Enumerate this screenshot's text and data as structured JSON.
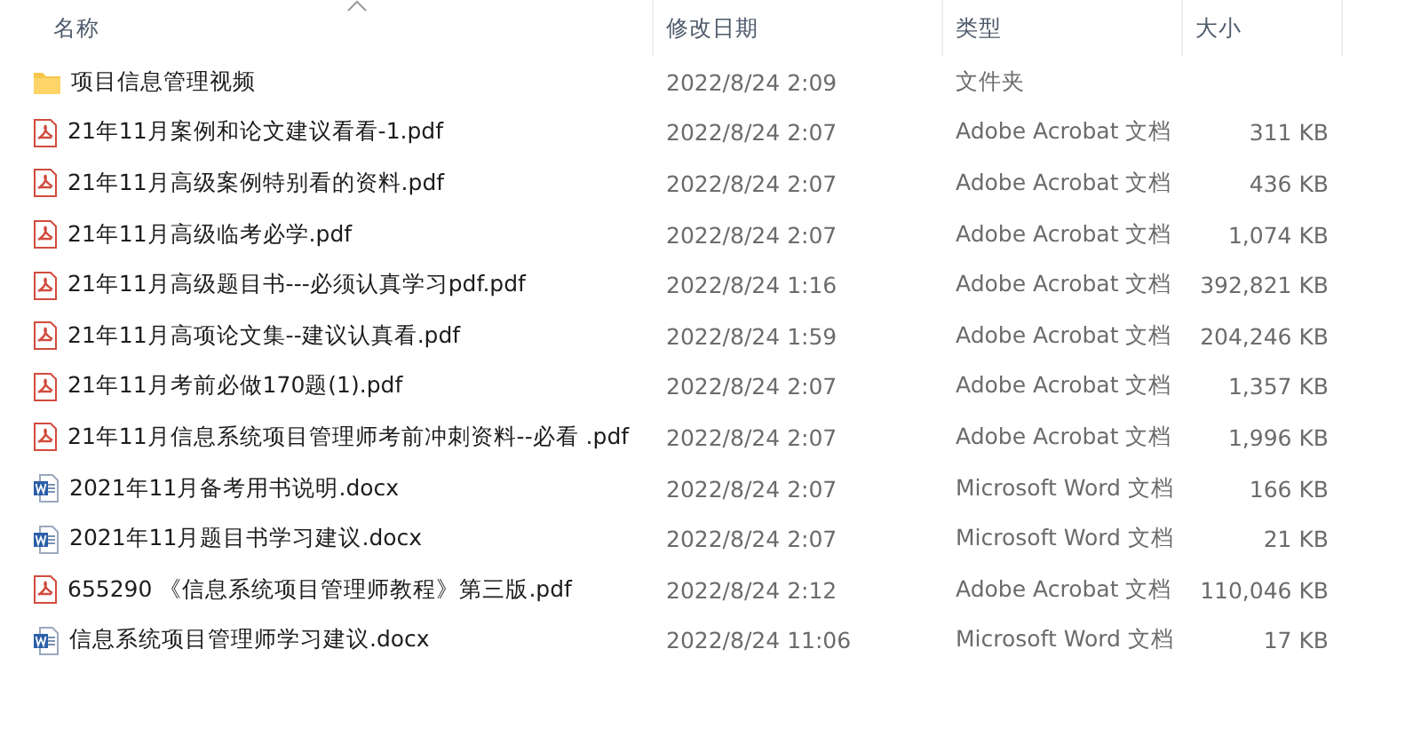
{
  "columns": [
    {
      "label": "名称",
      "sorted": true
    },
    {
      "label": "修改日期",
      "sorted": false
    },
    {
      "label": "类型",
      "sorted": false
    },
    {
      "label": "大小",
      "sorted": false
    }
  ],
  "rows": [
    {
      "kind": "folder",
      "name": "项目信息管理视频",
      "modified": "2022/8/24 2:09",
      "type": "文件夹"
    },
    {
      "kind": "pdf",
      "name": "21年11月案例和论文建议看看-1.pdf",
      "modified": "2022/8/24 2:07",
      "type": "Adobe Acrobat 文档",
      "size": "311 KB"
    },
    {
      "kind": "pdf",
      "name": "21年11月高级案例特别看的资料.pdf",
      "modified": "2022/8/24 2:07",
      "type": "Adobe Acrobat 文档",
      "size": "436 KB"
    },
    {
      "kind": "pdf",
      "name": "21年11月高级临考必学.pdf",
      "modified": "2022/8/24 2:07",
      "type": "Adobe Acrobat 文档",
      "size": "1,074 KB"
    },
    {
      "kind": "pdf",
      "name": "21年11月高级题目书---必须认真学习pdf.pdf",
      "modified": "2022/8/24 1:16",
      "type": "Adobe Acrobat 文档",
      "size": "392,821 KB"
    },
    {
      "kind": "pdf",
      "name": "21年11月高项论文集--建议认真看.pdf",
      "modified": "2022/8/24 1:59",
      "type": "Adobe Acrobat 文档",
      "size": "204,246 KB"
    },
    {
      "kind": "pdf",
      "name": "21年11月考前必做170题(1).pdf",
      "modified": "2022/8/24 2:07",
      "type": "Adobe Acrobat 文档",
      "size": "1,357 KB"
    },
    {
      "kind": "pdf",
      "name": "21年11月信息系统项目管理师考前冲刺资料--必看 .pdf",
      "modified": "2022/8/24 2:07",
      "type": "Adobe Acrobat 文档",
      "size": "1,996 KB"
    },
    {
      "kind": "word",
      "name": "2021年11月备考用书说明.docx",
      "modified": "2022/8/24 2:07",
      "type": "Microsoft Word 文档",
      "size": "166 KB"
    },
    {
      "kind": "word",
      "name": "2021年11月题目书学习建议.docx",
      "modified": "2022/8/24 2:07",
      "type": "Microsoft Word 文档",
      "size": "21 KB"
    },
    {
      "kind": "pdf",
      "name": "655290 《信息系统项目管理师教程》第三版.pdf",
      "modified": "2022/8/24 2:12",
      "type": "Adobe Acrobat 文档",
      "size": "110,046 KB"
    },
    {
      "kind": "word",
      "name": "信息系统项目管理师学习建议.docx",
      "modified": "2022/8/24 11:06",
      "type": "Microsoft Word 文档",
      "size": "17 KB"
    }
  ]
}
